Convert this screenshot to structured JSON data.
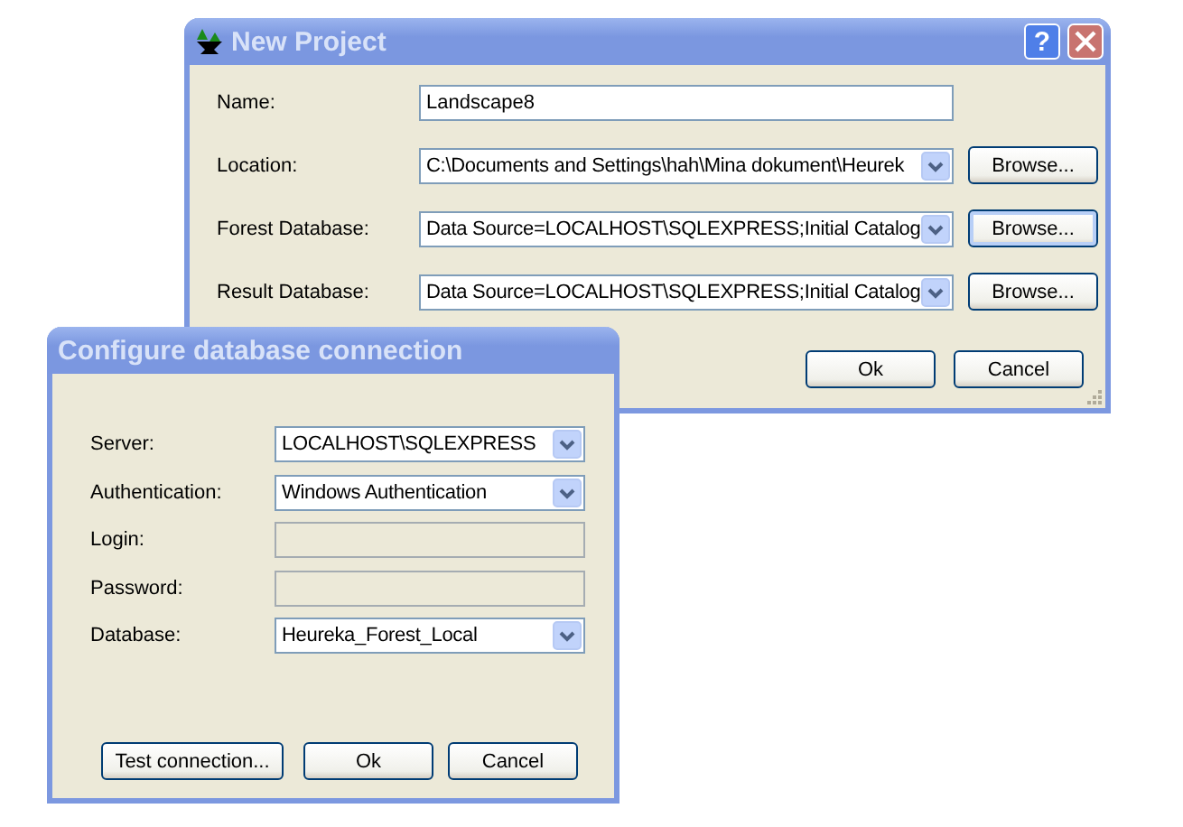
{
  "new_project": {
    "title": "New Project",
    "help_button": "?",
    "fields": [
      {
        "label": "Name:",
        "kind": "text",
        "value": "Landscape8",
        "disabled": false
      },
      {
        "label": "Location:",
        "kind": "combo",
        "value": "C:\\Documents and Settings\\hah\\Mina dokument\\Heurek",
        "button": "Browse...",
        "focused": false
      },
      {
        "label": "Forest Database:",
        "kind": "combo",
        "value": "Data Source=LOCALHOST\\SQLEXPRESS;Initial Catalog",
        "button": "Browse...",
        "focused": true
      },
      {
        "label": "Result Database:",
        "kind": "combo",
        "value": "Data Source=LOCALHOST\\SQLEXPRESS;Initial Catalog",
        "button": "Browse...",
        "focused": false
      }
    ],
    "buttons": [
      "Ok",
      "Cancel"
    ]
  },
  "configure_dialog": {
    "title": "Configure database connection",
    "fields": [
      {
        "label": "Server:",
        "kind": "combo",
        "value": "LOCALHOST\\SQLEXPRESS"
      },
      {
        "label": "Authentication:",
        "kind": "combo",
        "value": "Windows Authentication"
      },
      {
        "label": "Login:",
        "kind": "text",
        "disabled": true
      },
      {
        "label": "Password:",
        "kind": "text",
        "disabled": true
      },
      {
        "label": "Database:",
        "kind": "combo",
        "value": "Heureka_Forest_Local"
      }
    ],
    "buttons": [
      "Test connection...",
      "Ok",
      "Cancel"
    ]
  }
}
